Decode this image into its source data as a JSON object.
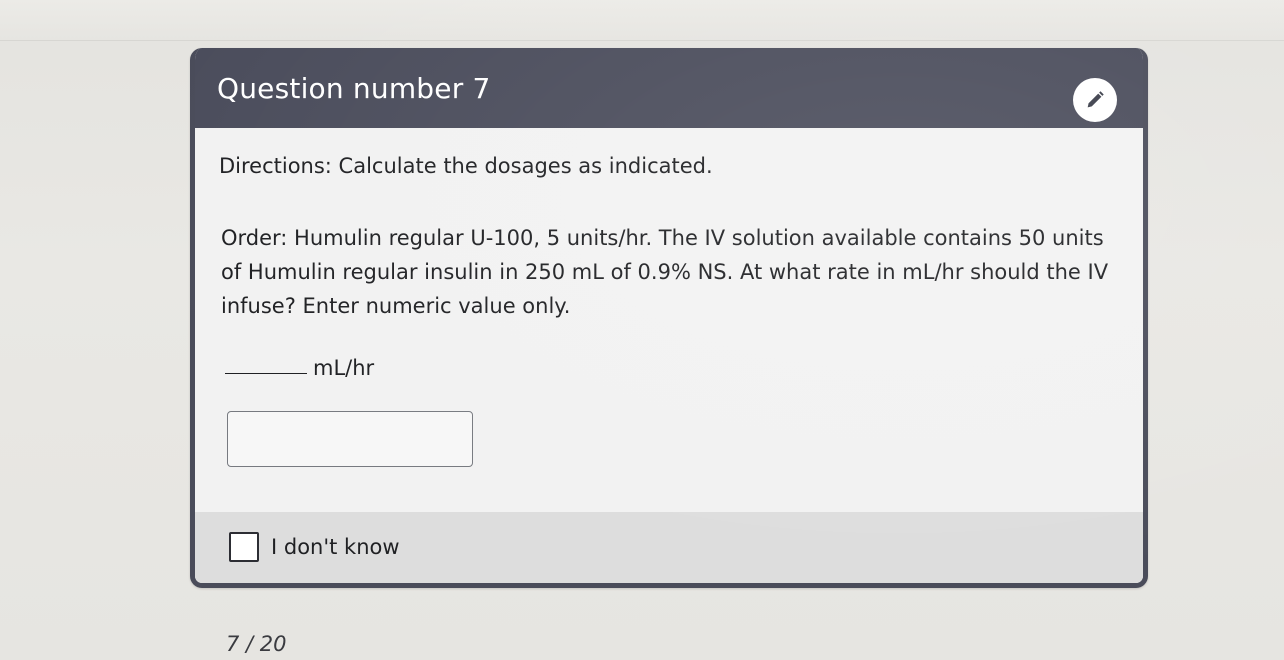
{
  "question": {
    "header_title": "Question number 7",
    "edit_icon": "pencil-icon",
    "directions": "Directions: Calculate the dosages as indicated.",
    "body_text": "Order: Humulin regular U-100, 5 units/hr. The IV solution available contains 50 units of Humulin regular insulin in 250 mL of 0.9% NS. At what rate in mL/hr should the IV infuse? Enter numeric value only.",
    "unit_label": "mL/hr",
    "answer_value": "",
    "dont_know_label": "I don't know",
    "dont_know_checked": false
  },
  "pagination": {
    "counter": "7 / 20"
  },
  "colors": {
    "header_bg": "#4b4d5c",
    "card_bg": "#f2f2f2",
    "footer_bg": "#dddddd"
  }
}
